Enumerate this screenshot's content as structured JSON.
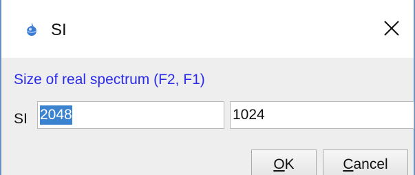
{
  "window": {
    "title": "SI",
    "icon": "topspin-app-icon",
    "close_icon": "close-icon"
  },
  "form": {
    "prompt": "Size of real spectrum (F2, F1)",
    "row_label": "SI",
    "f2_value": "2048",
    "f1_value": "1024"
  },
  "buttons": {
    "ok_mnemonic": "O",
    "ok_rest": "K",
    "cancel_mnemonic": "C",
    "cancel_rest": "ancel"
  },
  "colors": {
    "prompt_text": "#2a2ae8",
    "selection": "#3b82cf",
    "window_border": "#6d8ec0"
  }
}
